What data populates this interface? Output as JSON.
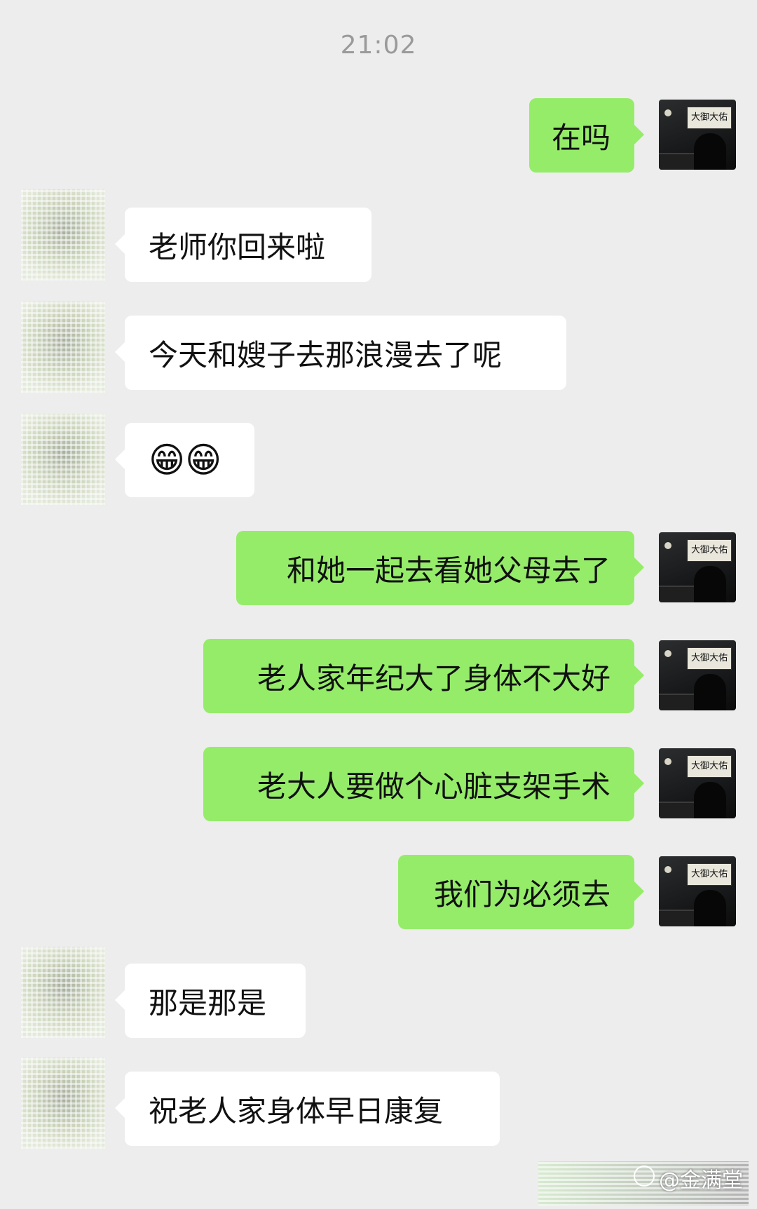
{
  "chat": {
    "timestamp": "21:02",
    "messages": [
      {
        "side": "out",
        "text": "在吗"
      },
      {
        "side": "in",
        "text": "老师你回来啦"
      },
      {
        "side": "in",
        "text": "今天和嫂子去那浪漫去了呢"
      },
      {
        "side": "in",
        "text": "😁😁"
      },
      {
        "side": "out",
        "text": "和她一起去看她父母去了"
      },
      {
        "side": "out",
        "text": "老人家年纪大了身体不大好"
      },
      {
        "side": "out",
        "text": "老大人要做个心脏支架手术"
      },
      {
        "side": "out",
        "text": "我们为必须去"
      },
      {
        "side": "in",
        "text": "那是那是"
      },
      {
        "side": "in",
        "text": "祝老人家身体早日康复"
      }
    ]
  },
  "avatar_me": {
    "sign_text": "大御大佑"
  },
  "watermark": {
    "text": "@金满堂"
  }
}
